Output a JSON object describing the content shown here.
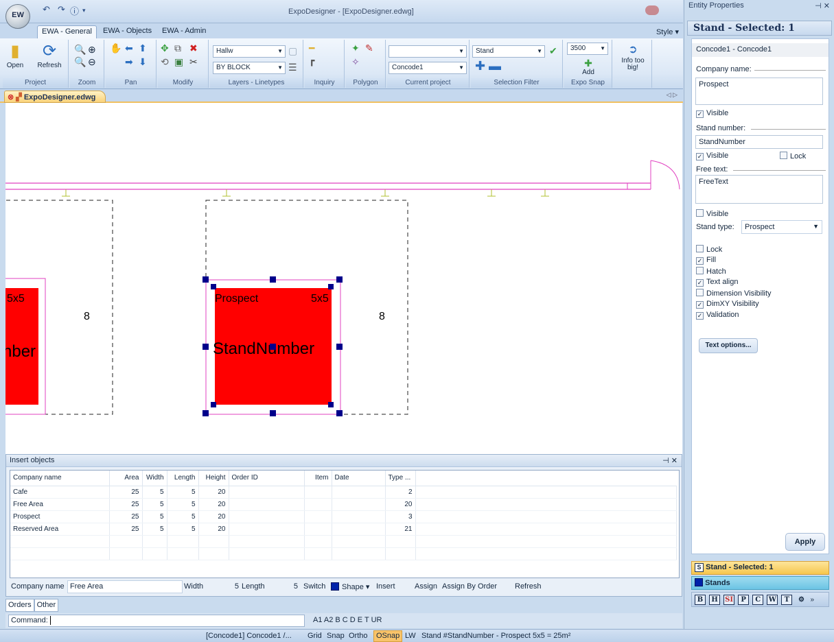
{
  "window": {
    "title": "ExpoDesigner - [ExpoDesigner.edwg]",
    "logo_text": "EW"
  },
  "ribbon": {
    "tabs": [
      "EWA - General",
      "EWA - Objects",
      "EWA - Admin"
    ],
    "style_label": "Style",
    "groups": {
      "project": {
        "label": "Project",
        "open": "Open",
        "refresh": "Refresh"
      },
      "zoom": {
        "label": "Zoom"
      },
      "pan": {
        "label": "Pan"
      },
      "modify": {
        "label": "Modify"
      },
      "layers": {
        "label": "Layers - Linetypes",
        "layer_value": "Hallw",
        "linetype_value": "BY BLOCK"
      },
      "inquiry": {
        "label": "Inquiry"
      },
      "polygon": {
        "label": "Polygon"
      },
      "current_project": {
        "label": "Current project",
        "top_value": "",
        "project_value": "Concode1"
      },
      "selection_filter": {
        "label": "Selection Filter",
        "value": "Stand"
      },
      "expo_snap": {
        "label": "Expo Snap",
        "value": "3500",
        "add": "Add"
      },
      "info": {
        "label": "Info too big!"
      }
    }
  },
  "document_tab": "ExpoDesigner.edwg",
  "canvas": {
    "stand_left": {
      "size": "5x5",
      "number_text": "nber",
      "side_number": "8"
    },
    "stand_selected": {
      "company": "Prospect",
      "size": "5x5",
      "number_text": "StandNumber",
      "side_number": "8"
    }
  },
  "insert_panel": {
    "title": "Insert objects",
    "columns": [
      "Company name",
      "Area",
      "Width",
      "Length",
      "Height",
      "Order ID",
      "Item",
      "Date",
      "Type ..."
    ],
    "rows": [
      [
        "Cafe",
        "25",
        "5",
        "5",
        "20",
        "",
        "",
        "",
        "2"
      ],
      [
        "Free Area",
        "25",
        "5",
        "5",
        "20",
        "",
        "",
        "",
        "20"
      ],
      [
        "Prospect",
        "25",
        "5",
        "5",
        "20",
        "",
        "",
        "",
        "3"
      ],
      [
        "Reserved Area",
        "25",
        "5",
        "5",
        "20",
        "",
        "",
        "",
        "21"
      ]
    ],
    "footer": {
      "company_label": "Company name",
      "company_value": "Free Area",
      "width_label": "Width",
      "width_value": "5",
      "length_label": "Length",
      "length_value": "5",
      "switch_label": "Switch",
      "shape_label": "Shape",
      "insert_label": "Insert",
      "assign_label": "Assign",
      "assign_by_order_label": "Assign By Order",
      "refresh_label": "Refresh"
    }
  },
  "bottom_tabs": [
    "Orders",
    "Other"
  ],
  "command": {
    "label": "Command:",
    "value": ""
  },
  "codes": "A1 A2 B C D E T UR",
  "status": {
    "project": "[Concode1] Concode1 /...",
    "grid": "Grid",
    "snap": "Snap",
    "ortho": "Ortho",
    "osnap": "OSnap",
    "lw": "LW",
    "info": "Stand #StandNumber - Prospect 5x5 = 25m²"
  },
  "properties": {
    "header": "Entity Properties",
    "title": "Stand - Selected: 1",
    "concode": "Concode1 - Concode1",
    "company_name_label": "Company name:",
    "company_name_value": "Prospect",
    "visible_label": "Visible",
    "stand_number_label": "Stand number:",
    "stand_number_value": "StandNumber",
    "lock_label": "Lock",
    "free_text_label": "Free text:",
    "free_text_value": "FreeText",
    "stand_type_label": "Stand type:",
    "stand_type_value": "Prospect",
    "options": [
      {
        "label": "Lock",
        "checked": false
      },
      {
        "label": "Fill",
        "checked": true
      },
      {
        "label": "Hatch",
        "checked": false
      },
      {
        "label": "Text align",
        "checked": true
      },
      {
        "label": "Dimension Visibility",
        "checked": false
      },
      {
        "label": "DimXY Visibility",
        "checked": true
      },
      {
        "label": "Validation",
        "checked": true
      }
    ],
    "text_options_label": "Text options...",
    "apply_label": "Apply",
    "nav_selected": "Stand - Selected: 1",
    "nav_stands": "Stands",
    "nav_icons": [
      "B",
      "H",
      "SI",
      "P",
      "C",
      "W",
      "T"
    ]
  },
  "colors": {
    "stand_fill": "#ff0000",
    "wall": "#e040c0",
    "grip": "#00008b",
    "osnap": "#f9c46a"
  }
}
